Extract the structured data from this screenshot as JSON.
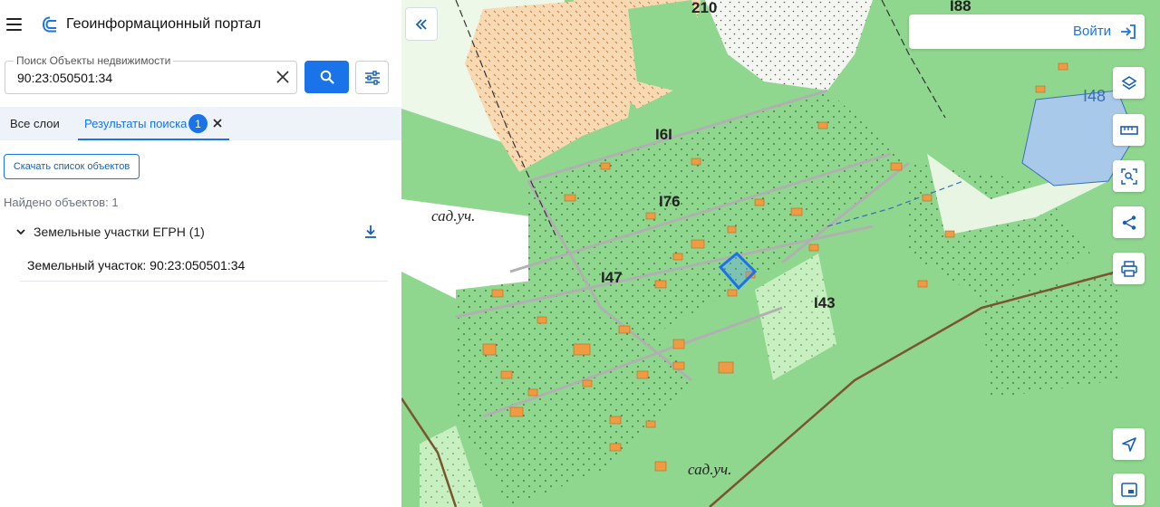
{
  "header": {
    "menu_icon": "menu-icon",
    "logo_icon": "portal-logo-icon",
    "title": "Геоинформационный портал"
  },
  "search": {
    "label": "Поиск Объекты недвижимости",
    "value": "90:23:050501:34",
    "clear_icon": "close-icon",
    "search_icon": "search-icon",
    "filter_icon": "sliders-icon"
  },
  "tabs": {
    "all_layers": "Все слои",
    "results": "Результаты поиска",
    "results_count": "1",
    "close_icon": "close-icon"
  },
  "results": {
    "download_list_label": "Скачать список объектов",
    "found_text": "Найдено объектов: 1",
    "group_title": "Земельные участки ЕГРН (1)",
    "items": [
      {
        "label": "Земельный участок: 90:23:050501:34"
      }
    ]
  },
  "map": {
    "login_label": "Войти",
    "labels": [
      "210",
      "I88",
      "I48",
      "I6I",
      "I76",
      "I47",
      "I43",
      "сад.уч.",
      "сад.уч."
    ],
    "tools": [
      "layers-icon",
      "ruler-icon",
      "area-select-icon",
      "share-icon",
      "print-icon",
      "navigate-icon",
      "minimap-icon"
    ],
    "colors": {
      "forest": "#8fd68f",
      "light_meadow": "#e8f5e2",
      "sand": "#f7d9b4",
      "water": "#a9c9ea",
      "building": "#f09a43",
      "road": "#b0b0b0",
      "highlight": "#1a73e8"
    }
  },
  "theme": {
    "accent": "#1a73e8"
  }
}
